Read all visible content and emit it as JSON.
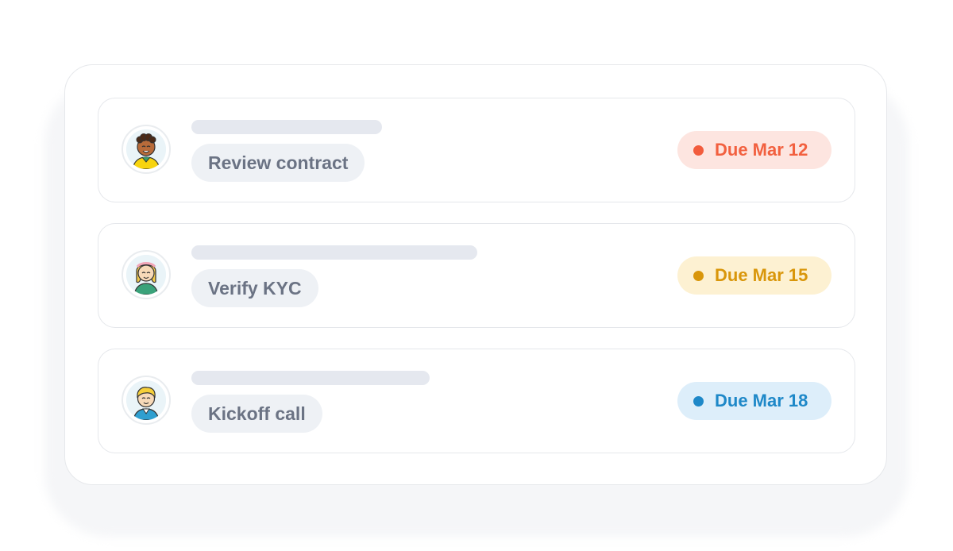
{
  "tasks": [
    {
      "title": "Review contract",
      "due": "Due Mar 12",
      "avatar_icon": "person-curly-hair-avatar-icon",
      "colors": {
        "bg": "#fde5e0",
        "fg": "#f2603f",
        "dot": "#f25c3d"
      }
    },
    {
      "title": "Verify KYC",
      "due": "Due Mar 15",
      "avatar_icon": "person-headband-avatar-icon",
      "colors": {
        "bg": "#fdf1d2",
        "fg": "#d9960a",
        "dot": "#d9960a"
      }
    },
    {
      "title": "Kickoff call",
      "due": "Due Mar 18",
      "avatar_icon": "person-blond-avatar-icon",
      "colors": {
        "bg": "#ddeefa",
        "fg": "#1e88c8",
        "dot": "#1e88c8"
      }
    }
  ]
}
